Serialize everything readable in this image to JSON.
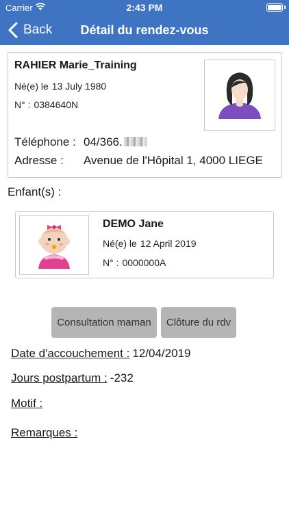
{
  "status_bar": {
    "carrier": "Carrier",
    "time": "2:43 PM"
  },
  "nav": {
    "back_label": "Back",
    "title": "Détail du rendez-vous"
  },
  "patient": {
    "name": "RAHIER Marie_Training",
    "birth_label": "Né(e) le",
    "birth_date": "13 July 1980",
    "number_label": "N° :",
    "number": "0384640N",
    "phone_label": "Téléphone :",
    "phone": "04/366.",
    "address_label": "Adresse :",
    "address": "Avenue de l'Hôpital 1, 4000 LIEGE",
    "avatar_icon": "woman-avatar-icon"
  },
  "children_label": "Enfant(s) :",
  "child": {
    "name": "DEMO Jane",
    "birth_label": "Né(e) le",
    "birth_date": "12 April 2019",
    "number_label": "N° :",
    "number": "0000000A",
    "avatar_icon": "baby-girl-avatar-icon"
  },
  "buttons": {
    "consultation": "Consultation maman",
    "close": "Clôture du rdv"
  },
  "info": {
    "delivery_label": "Date d'accouchement :",
    "delivery_value": "12/04/2019",
    "postpartum_label": "Jours postpartum :",
    "postpartum_value": "-232",
    "motif_label": "Motif :",
    "remarks_label": "Remarques :"
  },
  "colors": {
    "nav_bar": "#3f74c2",
    "button_bg": "#b5b5b5",
    "card_border": "#c9c9c9"
  }
}
